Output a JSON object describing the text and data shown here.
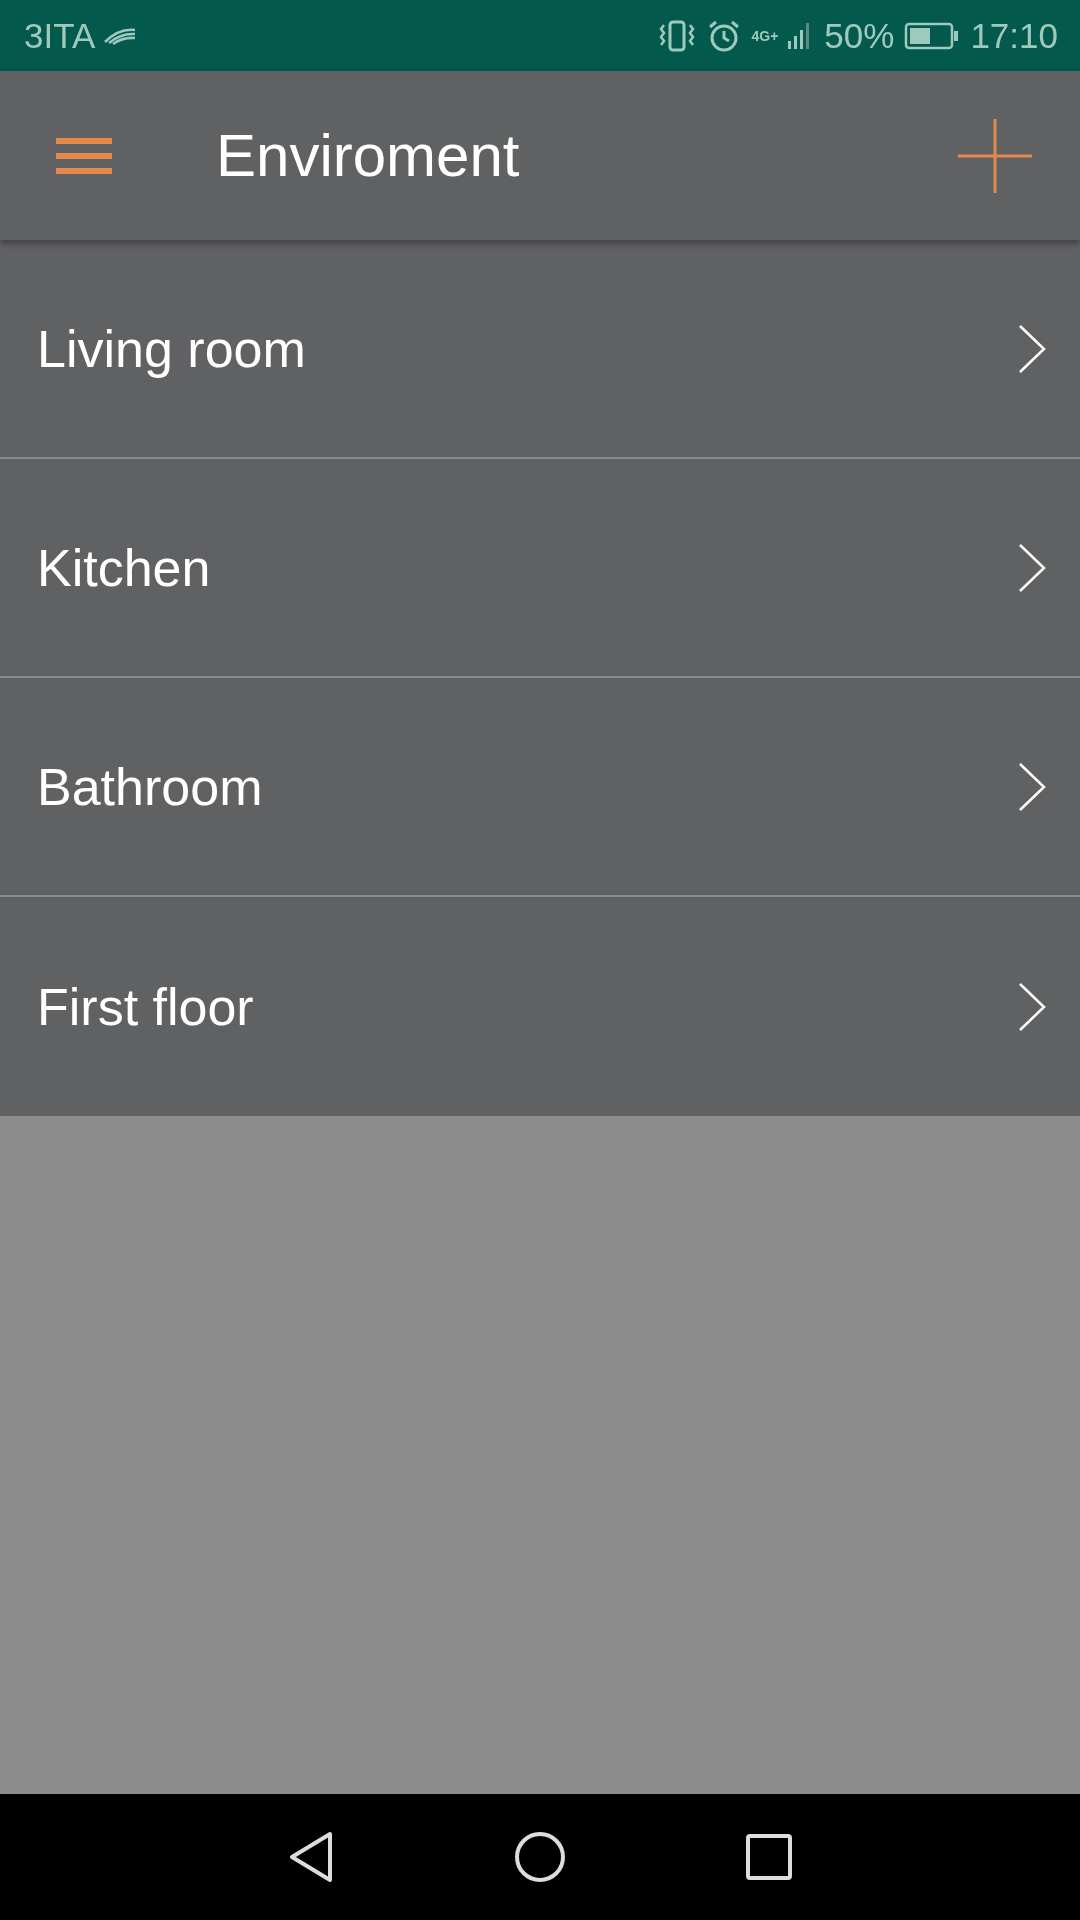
{
  "status_bar": {
    "carrier": "3ITA",
    "network": "4G+",
    "battery": "50%",
    "time": "17:10"
  },
  "toolbar": {
    "title": "Enviroment"
  },
  "rooms": [
    {
      "name": "Living room"
    },
    {
      "name": "Kitchen"
    },
    {
      "name": "Bathroom"
    },
    {
      "name": "First floor"
    }
  ]
}
